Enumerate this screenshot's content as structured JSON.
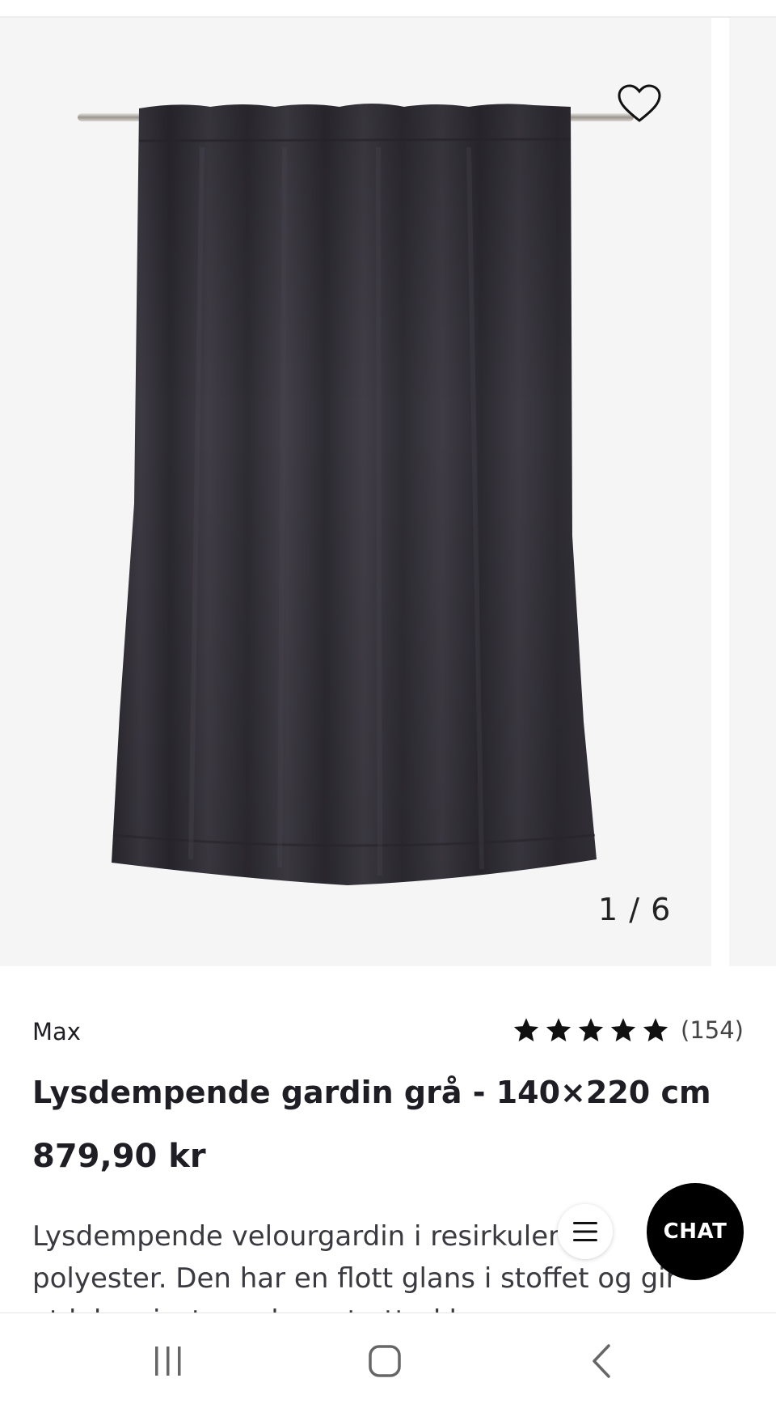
{
  "gallery": {
    "counter": "1 / 6",
    "favorite_icon": "heart-outline-icon",
    "image_subject": "dark grey velour curtain"
  },
  "product": {
    "brand": "Max",
    "rating": 5,
    "rating_max": 5,
    "review_count": "(154)",
    "title": "Lysdempende gardin grå - 140×220 cm",
    "price": "879,90 kr",
    "description": "Lysdempende velourgardin i resirkulert polyester. Den har en flott glans i stoffet og gir et luksuriøst og elegant uttrykk."
  },
  "fabs": {
    "menu_icon": "hamburger-icon",
    "chat_label": "CHAT"
  },
  "system_nav": {
    "recents_icon": "recents-icon",
    "home_icon": "home-icon",
    "back_icon": "back-icon"
  },
  "colors": {
    "accent": "#000000",
    "image_background": "#f5f5f5",
    "curtain": "#36333b"
  }
}
